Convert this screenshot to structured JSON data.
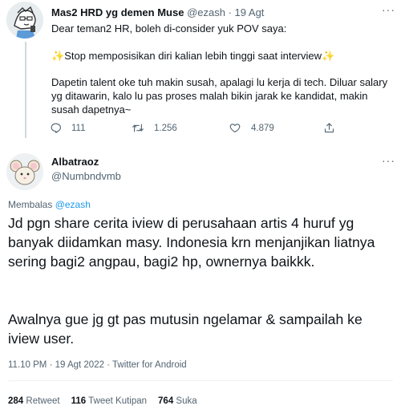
{
  "parent_tweet": {
    "display_name": "Mas2 HRD yg demen Muse",
    "handle": "@ezash",
    "date": "19 Agt",
    "line1": "Dear teman2 HR, boleh di-consider yuk POV saya:",
    "line2": "Stop memposisikan diri kalian lebih tinggi saat interview",
    "sparkle": "✨",
    "line3": "Dapetin talent oke tuh makin susah, apalagi lu kerja di tech. Diluar salary yg ditawarin, kalo lu pas proses malah bikin jarak ke kandidat, makin susah dapetnya~",
    "reply_count": "111",
    "retweet_count": "1.256",
    "like_count": "4.879"
  },
  "reply_tweet": {
    "display_name": "Albatraoz",
    "handle": "@Numbndvmb",
    "replying_prefix": "Membalas",
    "replying_to": "@ezash",
    "text1": "Jd pgn share cerita iview di perusahaan artis 4 huruf yg banyak diidamkan masy. Indonesia krn menjanjikan liatnya sering bagi2 angpau, bagi2 hp, ownernya baikkk.",
    "text2": "Awalnya gue jg gt pas mutusin ngelamar & sampailah ke iview user.",
    "timestamp": "11.10 PM · 19 Agt 2022 · Twitter for Android",
    "retweets_value": "284",
    "retweets_label": "Retweet",
    "quotes_value": "116",
    "quotes_label": "Tweet Kutipan",
    "likes_value": "764",
    "likes_label": "Suka"
  },
  "icons": {
    "more": "more-icon",
    "reply": "reply-icon",
    "retweet": "retweet-icon",
    "like": "heart-icon",
    "share": "share-icon"
  },
  "colors": {
    "text": "#0f1419",
    "secondary": "#536471",
    "accent": "#1d9bf0",
    "thread_line": "#cfd9de"
  }
}
